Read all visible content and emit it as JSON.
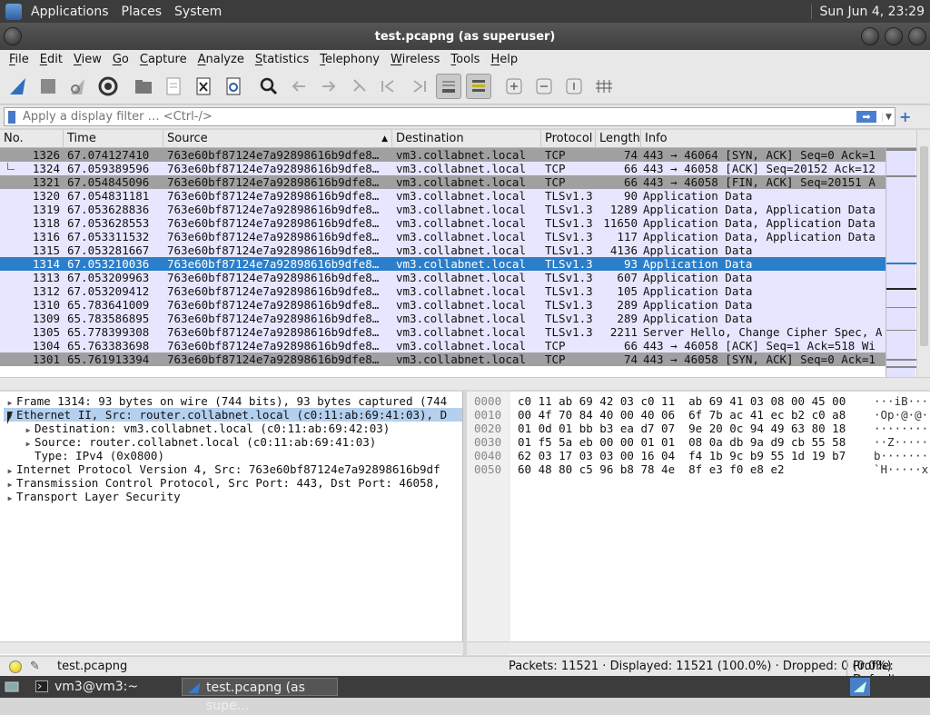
{
  "top_panel": {
    "menus": [
      "Applications",
      "Places",
      "System"
    ],
    "clock": "Sun Jun  4, 23:29"
  },
  "window": {
    "title": "test.pcapng (as superuser)"
  },
  "menu_bar": [
    "File",
    "Edit",
    "View",
    "Go",
    "Capture",
    "Analyze",
    "Statistics",
    "Telephony",
    "Wireless",
    "Tools",
    "Help"
  ],
  "toolbar": {
    "icons": [
      "shark-fin-start-icon",
      "stop-square-icon",
      "restart-fin-icon",
      "capture-options-gear-icon",
      "open-folder-icon",
      "save-file-icon",
      "close-file-icon",
      "reload-icon",
      "find-packet-icon",
      "go-back-icon",
      "go-forward-icon",
      "go-to-packet-icon",
      "first-packet-icon",
      "last-packet-icon",
      "autoscroll-icon",
      "colorize-icon",
      "zoom-in-icon",
      "zoom-out-icon",
      "normal-size-icon",
      "resize-columns-icon"
    ]
  },
  "filter": {
    "placeholder": "Apply a display filter … <Ctrl-/>",
    "apply_icon": "arrow-right-icon",
    "dropdown_icon": "chevron-down-icon",
    "add_icon": "plus-icon"
  },
  "packet_list": {
    "columns": [
      "No.",
      "Time",
      "Source",
      "Destination",
      "Protocol",
      "Length",
      "Info"
    ],
    "rows": [
      {
        "no": "1326",
        "time": "67.074127410",
        "src": "763e60bf87124e7a92898616b9dfe8…",
        "dst": "vm3.collabnet.local",
        "proto": "TCP",
        "len": "74",
        "info": "443 → 46064 [SYN, ACK] Seq=0 Ack=1",
        "style": "tcp-gray"
      },
      {
        "no": "1324",
        "time": "67.059389596",
        "src": "763e60bf87124e7a92898616b9dfe8…",
        "dst": "vm3.collabnet.local",
        "proto": "TCP",
        "len": "66",
        "info": "443 → 46058 [ACK] Seq=20152 Ack=12",
        "style": "lav"
      },
      {
        "no": "1321",
        "time": "67.054845096",
        "src": "763e60bf87124e7a92898616b9dfe8…",
        "dst": "vm3.collabnet.local",
        "proto": "TCP",
        "len": "66",
        "info": "443 → 46058 [FIN, ACK] Seq=20151 A",
        "style": "tcp-gray"
      },
      {
        "no": "1320",
        "time": "67.054831181",
        "src": "763e60bf87124e7a92898616b9dfe8…",
        "dst": "vm3.collabnet.local",
        "proto": "TLSv1.3",
        "len": "90",
        "info": "Application Data",
        "style": "lav"
      },
      {
        "no": "1319",
        "time": "67.053628836",
        "src": "763e60bf87124e7a92898616b9dfe8…",
        "dst": "vm3.collabnet.local",
        "proto": "TLSv1.3",
        "len": "1289",
        "info": "Application Data, Application Data",
        "style": "lav"
      },
      {
        "no": "1318",
        "time": "67.053628553",
        "src": "763e60bf87124e7a92898616b9dfe8…",
        "dst": "vm3.collabnet.local",
        "proto": "TLSv1.3",
        "len": "11650",
        "info": "Application Data, Application Data",
        "style": "lav"
      },
      {
        "no": "1316",
        "time": "67.053311532",
        "src": "763e60bf87124e7a92898616b9dfe8…",
        "dst": "vm3.collabnet.local",
        "proto": "TLSv1.3",
        "len": "117",
        "info": "Application Data, Application Data",
        "style": "lav"
      },
      {
        "no": "1315",
        "time": "67.053281667",
        "src": "763e60bf87124e7a92898616b9dfe8…",
        "dst": "vm3.collabnet.local",
        "proto": "TLSv1.3",
        "len": "4136",
        "info": "Application Data",
        "style": "lav"
      },
      {
        "no": "1314",
        "time": "67.053210036",
        "src": "763e60bf87124e7a92898616b9dfe8…",
        "dst": "vm3.collabnet.local",
        "proto": "TLSv1.3",
        "len": "93",
        "info": "Application Data",
        "style": "sel"
      },
      {
        "no": "1313",
        "time": "67.053209963",
        "src": "763e60bf87124e7a92898616b9dfe8…",
        "dst": "vm3.collabnet.local",
        "proto": "TLSv1.3",
        "len": "607",
        "info": "Application Data",
        "style": "lav"
      },
      {
        "no": "1312",
        "time": "67.053209412",
        "src": "763e60bf87124e7a92898616b9dfe8…",
        "dst": "vm3.collabnet.local",
        "proto": "TLSv1.3",
        "len": "105",
        "info": "Application Data",
        "style": "lav"
      },
      {
        "no": "1310",
        "time": "65.783641009",
        "src": "763e60bf87124e7a92898616b9dfe8…",
        "dst": "vm3.collabnet.local",
        "proto": "TLSv1.3",
        "len": "289",
        "info": "Application Data",
        "style": "lav"
      },
      {
        "no": "1309",
        "time": "65.783586895",
        "src": "763e60bf87124e7a92898616b9dfe8…",
        "dst": "vm3.collabnet.local",
        "proto": "TLSv1.3",
        "len": "289",
        "info": "Application Data",
        "style": "lav"
      },
      {
        "no": "1305",
        "time": "65.778399308",
        "src": "763e60bf87124e7a92898616b9dfe8…",
        "dst": "vm3.collabnet.local",
        "proto": "TLSv1.3",
        "len": "2211",
        "info": "Server Hello, Change Cipher Spec, A",
        "style": "lav"
      },
      {
        "no": "1304",
        "time": "65.763383698",
        "src": "763e60bf87124e7a92898616b9dfe8…",
        "dst": "vm3.collabnet.local",
        "proto": "TCP",
        "len": "66",
        "info": "443 → 46058 [ACK] Seq=1 Ack=518 Wi",
        "style": "lav"
      },
      {
        "no": "1301",
        "time": "65.761913394",
        "src": "763e60bf87124e7a92898616b9dfe8…",
        "dst": "vm3.collabnet.local",
        "proto": "TCP",
        "len": "74",
        "info": "443 → 46058 [SYN, ACK] Seq=0 Ack=1",
        "style": "tcp-gray"
      }
    ]
  },
  "details": [
    {
      "text": "Frame 1314: 93 bytes on wire (744 bits), 93 bytes captured (744",
      "expander": "right",
      "sel": false
    },
    {
      "text": "Ethernet II, Src: router.collabnet.local (c0:11:ab:69:41:03), D",
      "expander": "down",
      "sel": true
    },
    {
      "text": "Destination: vm3.collabnet.local (c0:11:ab:69:42:03)",
      "expander": "right",
      "sel": false
    },
    {
      "text": "Source: router.collabnet.local (c0:11:ab:69:41:03)",
      "expander": "right",
      "sel": false
    },
    {
      "text": "Type: IPv4 (0x0800)",
      "expander": "none",
      "sel": false
    },
    {
      "text": "Internet Protocol Version 4, Src: 763e60bf87124e7a92898616b9df",
      "expander": "right",
      "sel": false
    },
    {
      "text": "Transmission Control Protocol, Src Port: 443, Dst Port: 46058,",
      "expander": "right",
      "sel": false
    },
    {
      "text": "Transport Layer Security",
      "expander": "right",
      "sel": false
    }
  ],
  "bytes": [
    {
      "off": "0000",
      "hex": "c0 11 ab 69 42 03 c0 11  ab 69 41 03 08 00 45 00",
      "asc": "···iB···"
    },
    {
      "off": "0010",
      "hex": "00 4f 70 84 40 00 40 06  6f 7b ac 41 ec b2 c0 a8",
      "asc": "·Op·@·@·"
    },
    {
      "off": "0020",
      "hex": "01 0d 01 bb b3 ea d7 07  9e 20 0c 94 49 63 80 18",
      "asc": "········"
    },
    {
      "off": "0030",
      "hex": "01 f5 5a eb 00 00 01 01  08 0a db 9a d9 cb 55 58",
      "asc": "··Z·····"
    },
    {
      "off": "0040",
      "hex": "62 03 17 03 03 00 16 04  f4 1b 9c b9 55 1d 19 b7",
      "asc": "b·······"
    },
    {
      "off": "0050",
      "hex": "60 48 80 c5 96 b8 78 4e  8f e3 f0 e8 e2",
      "asc": "`H·····x"
    }
  ],
  "status": {
    "file": "test.pcapng",
    "stats": "Packets: 11521 · Displayed: 11521 (100.0%) · Dropped: 0 (0.0%)",
    "profile": "Profile: Default"
  },
  "taskbar": [
    {
      "label": "vm3@vm3:~",
      "icon": "terminal-icon",
      "active": false
    },
    {
      "label": "test.pcapng (as supe…",
      "icon": "wireshark-fin-icon",
      "active": true
    }
  ]
}
